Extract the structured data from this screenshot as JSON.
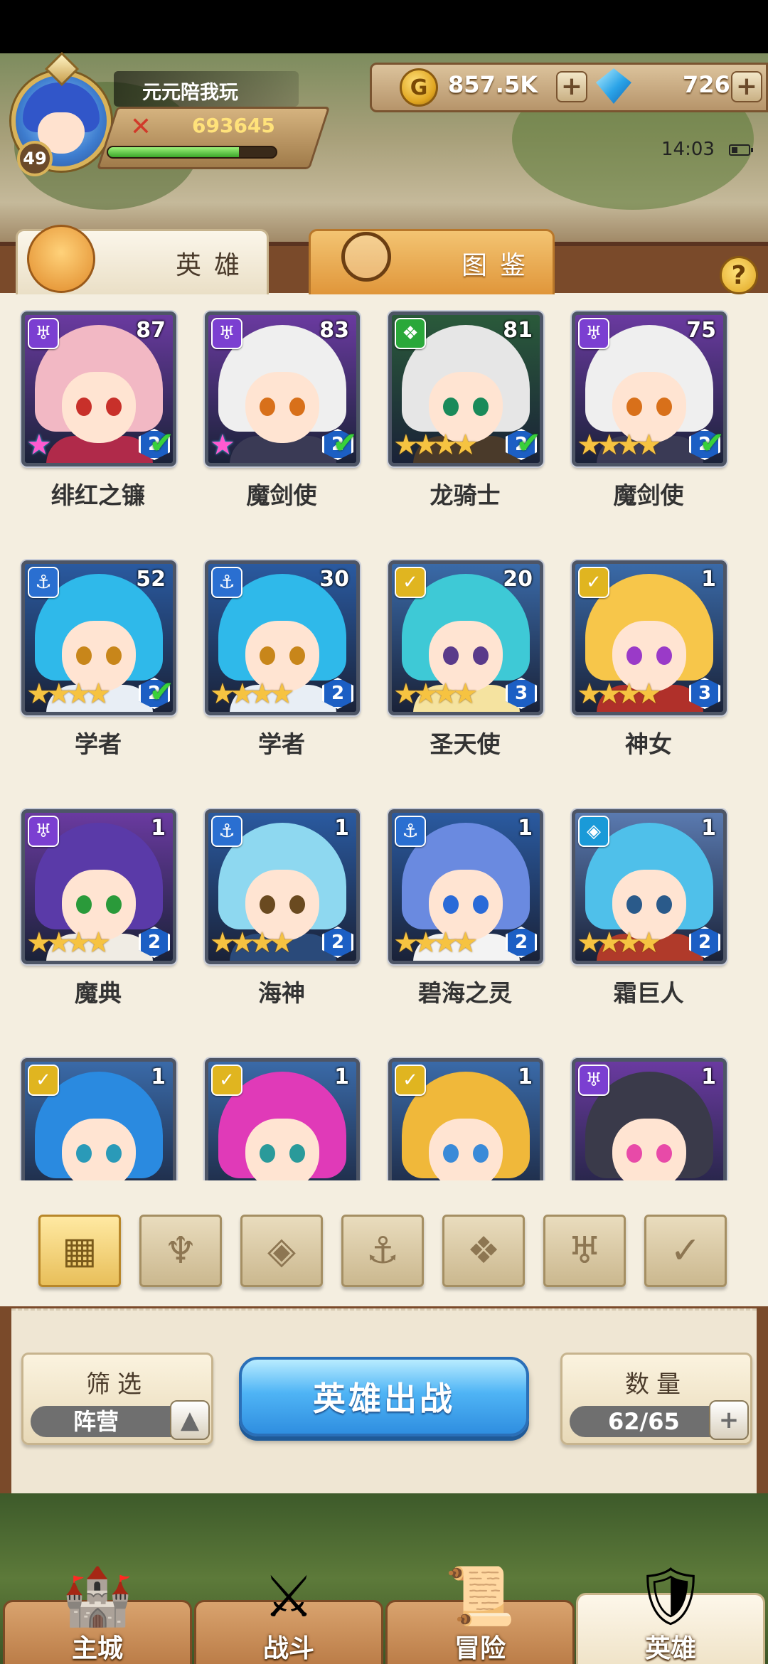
{
  "player": {
    "name": "元元陪我玩",
    "level": "49",
    "power": "693645",
    "exp_fraction": 0.78
  },
  "resources": {
    "gold": "857.5K",
    "gems": "726",
    "plus": "+"
  },
  "status": {
    "time": "14:03"
  },
  "tabs": {
    "heroes": "英雄",
    "codex": "图鉴"
  },
  "help": "?",
  "heroes": [
    {
      "name": "绯红之镰",
      "level": "87",
      "faction": "demon",
      "faction_color": "#7b3fd1",
      "stars": "★",
      "rainbow": true,
      "rank": "2",
      "check": true,
      "hair": "#f2b8c4",
      "eye": "#c8302a",
      "body": "#b02a4a"
    },
    {
      "name": "魔剑使",
      "level": "83",
      "faction": "demon",
      "faction_color": "#7b3fd1",
      "stars": "★",
      "rainbow": true,
      "rank": "2",
      "check": true,
      "hair": "#efefef",
      "eye": "#d8701a",
      "body": "#3a3a55"
    },
    {
      "name": "龙骑士",
      "level": "81",
      "faction": "beast",
      "faction_color": "#2aa83a",
      "stars": "★★★★",
      "rank": "2",
      "check": true,
      "hair": "#e6e6e6",
      "eye": "#1a8a5a",
      "body": "#4a3a2a"
    },
    {
      "name": "魔剑使",
      "level": "75",
      "faction": "demon",
      "faction_color": "#7b3fd1",
      "stars": "★★★★",
      "rank": "2",
      "check": true,
      "hair": "#efefef",
      "eye": "#d8701a",
      "body": "#3a3a55"
    },
    {
      "name": "学者",
      "level": "52",
      "faction": "ocean",
      "faction_color": "#2a6fd1",
      "stars": "★★★★",
      "rank": "2",
      "check": true,
      "hair": "#2fb9ea",
      "eye": "#c8861a",
      "body": "#e8eef5"
    },
    {
      "name": "学者",
      "level": "30",
      "faction": "ocean",
      "faction_color": "#2a6fd1",
      "stars": "★★★★",
      "rank": "2",
      "check": false,
      "hair": "#2fb9ea",
      "eye": "#c8861a",
      "body": "#e8eef5"
    },
    {
      "name": "圣天使",
      "level": "20",
      "faction": "holy",
      "faction_color": "#e0b520",
      "stars": "★★★★",
      "rank": "3",
      "check": false,
      "hair": "#3ec9d6",
      "eye": "#5a3a8a",
      "body": "#f5e3a0"
    },
    {
      "name": "神女",
      "level": "1",
      "faction": "holy",
      "faction_color": "#e0b520",
      "stars": "★★★★",
      "rank": "3",
      "check": false,
      "hair": "#f7c64a",
      "eye": "#9a3ac8",
      "body": "#b0302a"
    },
    {
      "name": "魔典",
      "level": "1",
      "faction": "demon",
      "faction_color": "#7b3fd1",
      "stars": "★★★★",
      "rank": "2",
      "check": false,
      "hair": "#5a3aa8",
      "eye": "#2a9a3a",
      "body": "#f0ece4"
    },
    {
      "name": "海神",
      "level": "1",
      "faction": "ocean",
      "faction_color": "#2a6fd1",
      "stars": "★★★★",
      "rank": "2",
      "check": false,
      "hair": "#8ed8f0",
      "eye": "#6a4a20",
      "body": "#2a4a7a"
    },
    {
      "name": "碧海之灵",
      "level": "1",
      "faction": "ocean",
      "faction_color": "#2a6fd1",
      "stars": "★★★★",
      "rank": "2",
      "check": false,
      "hair": "#6a8ae0",
      "eye": "#2a6ad8",
      "body": "#f3f3f3"
    },
    {
      "name": "霜巨人",
      "level": "1",
      "faction": "nature",
      "faction_color": "#1a9ad8",
      "stars": "★★★★",
      "rank": "2",
      "check": false,
      "hair": "#4fc0ea",
      "eye": "#2a5a8a",
      "body": "#b03a2a"
    },
    {
      "name": "",
      "level": "1",
      "faction": "holy",
      "faction_color": "#e0b520",
      "stars": "",
      "rank": "",
      "check": false,
      "hair": "#2a8ae0",
      "eye": "#2a9ab8",
      "body": "#a06a3a"
    },
    {
      "name": "",
      "level": "1",
      "faction": "holy",
      "faction_color": "#e0b520",
      "stars": "",
      "rank": "",
      "check": false,
      "hair": "#e03ab8",
      "eye": "#2a9a9a",
      "body": "#c84ad0"
    },
    {
      "name": "",
      "level": "1",
      "faction": "holy",
      "faction_color": "#e0b520",
      "stars": "",
      "rank": "",
      "check": false,
      "hair": "#f0b83a",
      "eye": "#3a8ad8",
      "body": "#e8e8f0"
    },
    {
      "name": "",
      "level": "1",
      "faction": "demon",
      "faction_color": "#7b3fd1",
      "stars": "",
      "rank": "",
      "check": false,
      "hair": "#3a3a4a",
      "eye": "#e84aa8",
      "body": "#5a4a8a"
    }
  ],
  "filters": [
    {
      "icon": "all-grid-icon",
      "glyph": "▦",
      "active": true
    },
    {
      "icon": "nature-faction-icon",
      "glyph": "♆",
      "active": false
    },
    {
      "icon": "crystal-faction-icon",
      "glyph": "◈",
      "active": false
    },
    {
      "icon": "anchor-faction-icon",
      "glyph": "⚓",
      "active": false
    },
    {
      "icon": "beast-faction-icon",
      "glyph": "❖",
      "active": false
    },
    {
      "icon": "demon-faction-icon",
      "glyph": "♅",
      "active": false
    },
    {
      "icon": "holy-faction-icon",
      "glyph": "✓",
      "active": false
    }
  ],
  "controls": {
    "filter_title": "筛选",
    "filter_value": "阵营",
    "deploy": "英雄出战",
    "count_title": "数量",
    "count_value": "62/65"
  },
  "nav": [
    {
      "label": "主城",
      "icon": "castle-icon",
      "glyph": "🏰",
      "active": false
    },
    {
      "label": "战斗",
      "icon": "crossed-swords-icon",
      "glyph": "⚔",
      "active": false
    },
    {
      "label": "冒险",
      "icon": "scroll-map-icon",
      "glyph": "📜",
      "active": false
    },
    {
      "label": "英雄",
      "icon": "hero-helmet-icon",
      "glyph": "🛡",
      "active": true
    }
  ]
}
